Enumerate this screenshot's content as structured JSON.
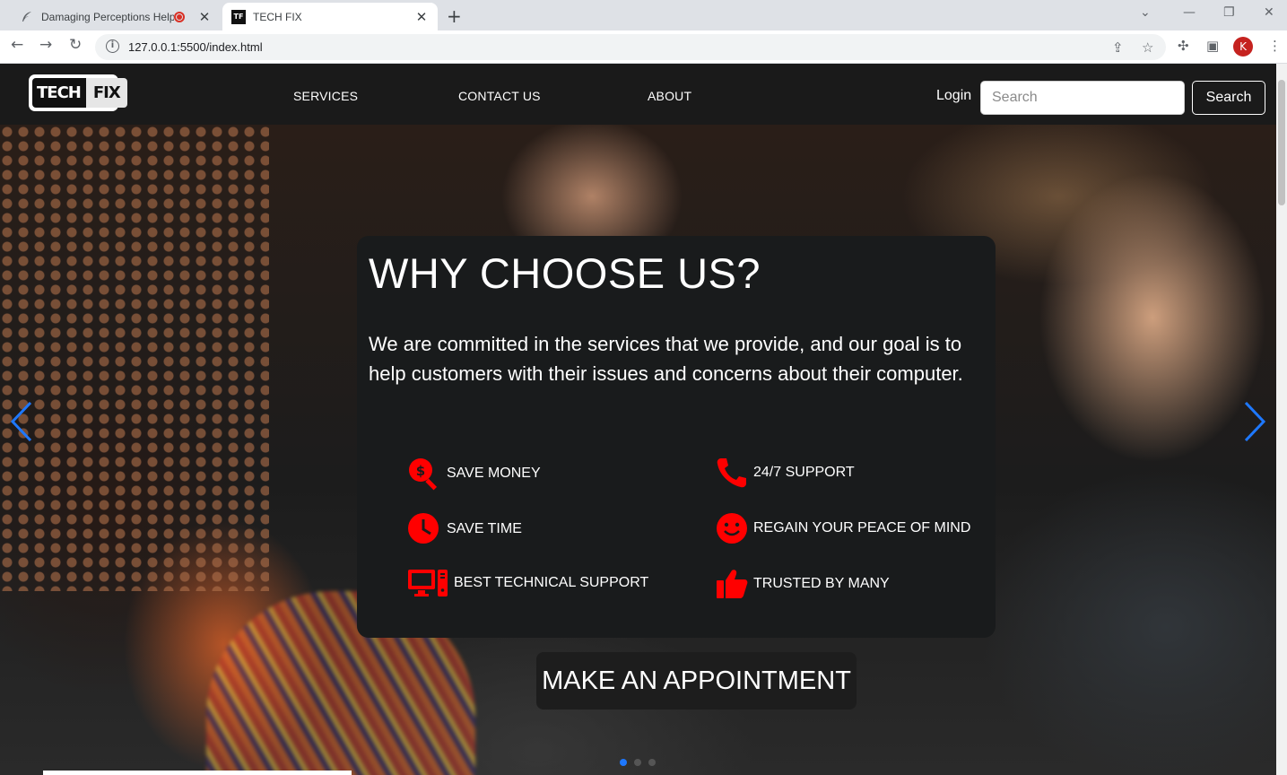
{
  "browser": {
    "tabs": [
      {
        "title": "Damaging Perceptions Help",
        "active": false
      },
      {
        "title": "TECH FIX",
        "active": true
      }
    ],
    "favicon_text": "TF",
    "url": "127.0.0.1:5500/index.html",
    "profile_initial": "K"
  },
  "nav": {
    "logo_tech": "TECH",
    "logo_fix": "FIX",
    "links": [
      "SERVICES",
      "CONTACT US",
      "ABOUT"
    ],
    "login": "Login",
    "search_placeholder": "Search",
    "search_button": "Search"
  },
  "hero": {
    "title": "WHY CHOOSE US?",
    "description": "We are committed in the services that we provide, and our goal is to help customers with their issues and concerns about their computer.",
    "features": [
      {
        "label": "SAVE MONEY",
        "icon": "money-search-icon"
      },
      {
        "label": "24/7 SUPPORT",
        "icon": "phone-icon"
      },
      {
        "label": "SAVE TIME",
        "icon": "clock-icon"
      },
      {
        "label": "REGAIN YOUR PEACE OF MIND",
        "icon": "smile-icon"
      },
      {
        "label": "BEST TECHNICAL SUPPORT",
        "icon": "computer-icon"
      },
      {
        "label": "TRUSTED BY MANY",
        "icon": "thumbs-up-icon"
      }
    ],
    "cta": "MAKE AN APPOINTMENT",
    "carousel": {
      "slides": 3,
      "active": 1
    }
  },
  "colors": {
    "accent": "#ff0000",
    "carousel_blue": "#1e78ff",
    "navbar": "#1a1a1a",
    "card": "#191b1c"
  }
}
